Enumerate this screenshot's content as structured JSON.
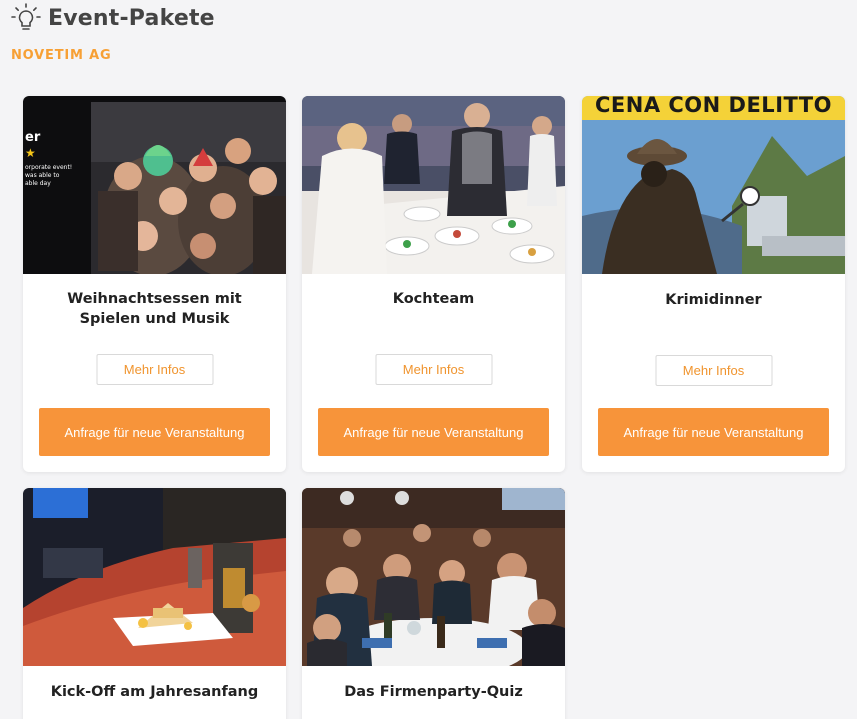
{
  "header": {
    "title": "Event-Pakete",
    "company": "NOVETIM AG"
  },
  "colors": {
    "accent": "#f7943a",
    "accent_text": "#f0942e",
    "company_text": "#f7a035",
    "background": "#f4f4f6"
  },
  "cards": [
    {
      "title": "Weihnachtsessen mit Spielen und Musik",
      "image_overlay": {
        "heading": "er",
        "stars": "★",
        "line1": "orporate event!",
        "line2": "was able to",
        "line3": "able day"
      },
      "more_label": "Mehr Infos",
      "request_label": "Anfrage für neue Veranstaltung"
    },
    {
      "title": "Kochteam",
      "more_label": "Mehr Infos",
      "request_label": "Anfrage für neue Veranstaltung"
    },
    {
      "title": "Krimidinner",
      "image_text": "CENA CON DELITTO",
      "more_label": "Mehr Infos",
      "request_label": "Anfrage für neue Veranstaltung"
    },
    {
      "title": "Kick-Off am Jahresanfang"
    },
    {
      "title": "Das Firmenparty-Quiz"
    }
  ]
}
